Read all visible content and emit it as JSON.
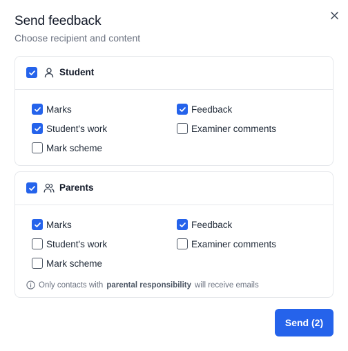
{
  "dialog": {
    "title": "Send feedback",
    "subtitle": "Choose recipient and content",
    "close_icon": "close-icon"
  },
  "sections": [
    {
      "label": "Student",
      "icon": "user-icon",
      "checked": true,
      "options": [
        {
          "label": "Marks",
          "checked": true
        },
        {
          "label": "Feedback",
          "checked": true
        },
        {
          "label": "Student's work",
          "checked": true
        },
        {
          "label": "Examiner comments",
          "checked": false
        },
        {
          "label": "Mark scheme",
          "checked": false
        }
      ]
    },
    {
      "label": "Parents",
      "icon": "users-icon",
      "checked": true,
      "options": [
        {
          "label": "Marks",
          "checked": true
        },
        {
          "label": "Feedback",
          "checked": true
        },
        {
          "label": "Student's work",
          "checked": false
        },
        {
          "label": "Examiner comments",
          "checked": false
        },
        {
          "label": "Mark scheme",
          "checked": false
        }
      ],
      "note": {
        "icon": "info-icon",
        "prefix": "Only contacts with",
        "emphasis": "parental responsibility",
        "suffix": "will receive emails"
      }
    }
  ],
  "send_button": {
    "label": "Send (2)"
  },
  "colors": {
    "accent": "#2563eb",
    "muted_text": "#6b7280",
    "border": "#e5e7eb"
  }
}
